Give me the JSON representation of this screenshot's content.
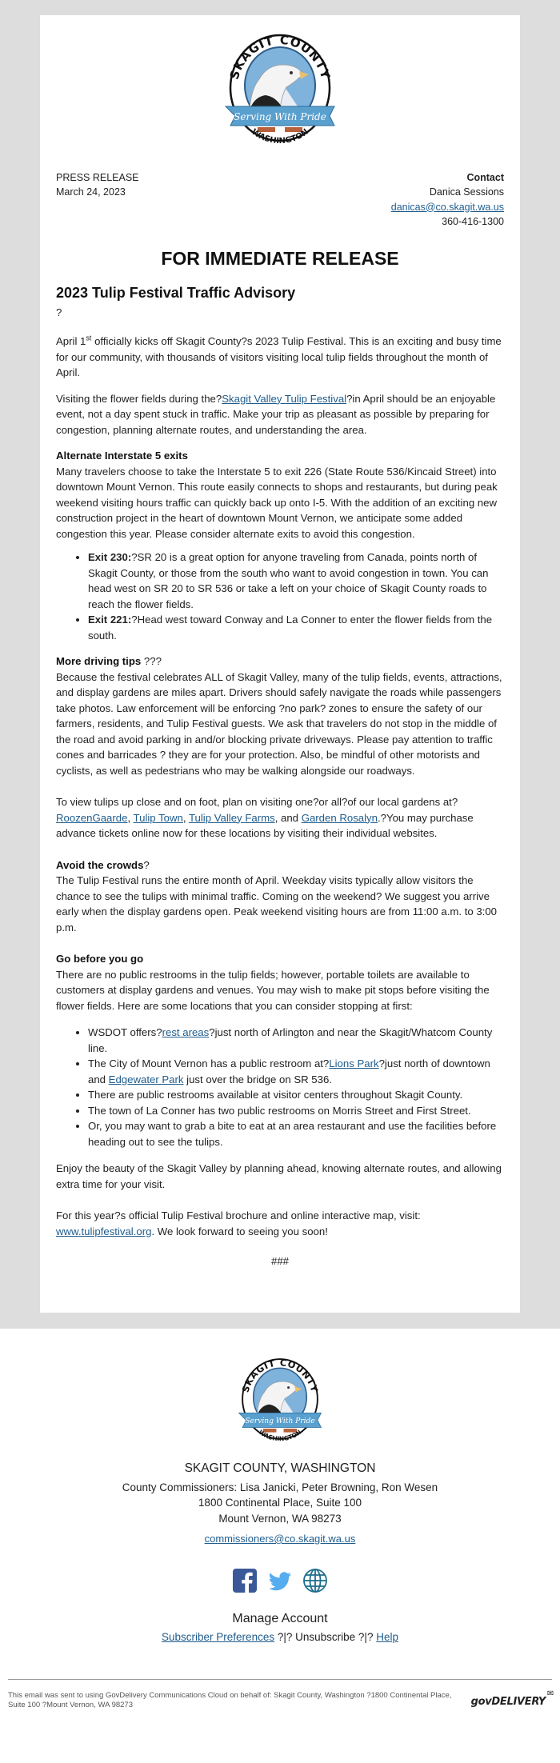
{
  "logo": {
    "top_text": "SKAGIT COUNTY",
    "ribbon_text": "Serving With Pride",
    "bottom_text": "WASHINGTON"
  },
  "header": {
    "left_line1": "PRESS RELEASE",
    "left_line2": "March 24, 2023",
    "contact_label": "Contact",
    "contact_name": "Danica Sessions",
    "contact_email": "danicas@co.skagit.wa.us",
    "contact_phone": "360-416-1300"
  },
  "release_heading": "FOR IMMEDIATE RELEASE",
  "title": "2023 Tulip Festival Traffic Advisory",
  "stray_char": "?",
  "intro": {
    "p1_a": "April 1",
    "p1_sup": "st",
    "p1_b": " officially kicks off Skagit County?s 2023 Tulip Festival. This is an exciting and busy time for our community, with thousands of visitors visiting local tulip fields throughout the month of April.",
    "p2_a": "Visiting the flower fields during the?",
    "p2_link": "Skagit Valley Tulip Festival",
    "p2_b": "?in April should be an enjoyable event, not a day spent stuck in traffic. Make your trip as pleasant as possible by preparing for congestion, planning alternate routes, and understanding the area."
  },
  "alt_exits": {
    "heading": "Alternate Interstate 5 exits",
    "body": "Many travelers choose to take the Interstate 5 to exit 226 (State Route 536/Kincaid Street) into downtown Mount Vernon. This route easily connects to shops and restaurants, but during peak weekend visiting hours traffic can quickly back up onto I-5. With the addition of an exciting new construction project in the heart of downtown Mount Vernon, we anticipate some added congestion this year. Please consider alternate exits to avoid this congestion.",
    "items": [
      {
        "label": "Exit 230:",
        "text": "?SR 20 is a great option for anyone traveling from Canada, points north of Skagit County, or those from the south who want to avoid congestion in town. You can head west on SR 20 to SR 536 or take a left on your choice of Skagit County roads to reach the flower fields."
      },
      {
        "label": "Exit 221:",
        "text": "?Head west toward Conway and La Conner to enter the flower fields from the south."
      }
    ]
  },
  "driving_tips": {
    "heading": "More driving tips",
    "heading_suffix": " ???",
    "body": "Because the festival celebrates ALL of Skagit Valley, many of the tulip fields, events, attractions, and display gardens are miles apart. Drivers should safely navigate the roads while passengers take photos. Law enforcement will be enforcing ?no park? zones to ensure the safety of our farmers, residents, and Tulip Festival guests. We ask that travelers do not stop in the middle of the road and avoid parking in and/or blocking private driveways. Please pay attention to traffic cones and barricades ? they are for your protection. Also, be mindful of other motorists and cyclists, as well as pedestrians who may be walking alongside our roadways."
  },
  "gardens": {
    "text_a": "To view tulips up close and on foot, plan on visiting one?or all?of our local gardens at?",
    "links": [
      "RoozenGaarde",
      "Tulip Town",
      "Tulip Valley Farms",
      "Garden Rosalyn"
    ],
    "sep1": ", ",
    "sep2": ", ",
    "sep3": ", and ",
    "text_b": ".?You may purchase advance tickets online now for these locations by visiting their individual websites."
  },
  "crowds": {
    "heading": "Avoid the crowds",
    "heading_suffix": "?",
    "body": "The Tulip Festival runs the entire month of April. Weekday visits typically allow visitors the chance to see the tulips with minimal traffic. Coming on the weekend? We suggest you arrive early when the display gardens open. Peak weekend visiting hours are from 11:00 a.m. to 3:00 p.m."
  },
  "restrooms": {
    "heading": "Go before you go",
    "body": "There are no public restrooms in the tulip fields; however, portable toilets are available to customers at display gardens and venues. You may wish to make pit stops before visiting the flower fields. Here are some locations that you can consider stopping at first:",
    "item1_a": "WSDOT offers?",
    "item1_link": "rest areas",
    "item1_b": "?just north of Arlington and near the Skagit/Whatcom County line.",
    "item2_a": "The City of Mount Vernon has a public restroom at?",
    "item2_link1": "Lions Park",
    "item2_b": "?just north of downtown and ",
    "item2_link2": "Edgewater Park",
    "item2_c": " just over the bridge on SR 536.",
    "item3": "There are public restrooms available at visitor centers throughout Skagit County.",
    "item4": "The town of La Conner has two public restrooms on Morris Street and First Street.",
    "item5": "Or, you may want to grab a bite to eat at an area restaurant and use the facilities before heading out to see the tulips."
  },
  "closing": {
    "p1": "Enjoy the beauty of the Skagit Valley by planning ahead, knowing alternate routes, and allowing extra time for your visit.",
    "p2_a": "For this year?s official Tulip Festival brochure and online interactive map, visit: ",
    "p2_link": "www.tulipfestival.org",
    "p2_b": ". We look forward to seeing you soon!",
    "end_mark": "###"
  },
  "footer": {
    "org": "SKAGIT COUNTY, WASHINGTON",
    "commissioners": "County Commissioners: Lisa Janicki, Peter Browning, Ron Wesen",
    "address1": "1800 Continental Place, Suite 100",
    "address2": "Mount Vernon, WA 98273",
    "email": "commissioners@co.skagit.wa.us",
    "social": [
      "facebook-icon",
      "twitter-icon",
      "globe-icon"
    ],
    "manage_account": "Manage Account",
    "subscriber_prefs": "Subscriber Preferences",
    "sep": " ?|? ",
    "unsubscribe": "Unsubscribe",
    "help": "Help",
    "disclaimer": "This email was sent to using GovDelivery Communications Cloud on behalf of: Skagit County, Washington ?1800 Continental Place, Suite 100 ?Mount Vernon, WA 98273",
    "govdelivery": "govDELIVERY"
  },
  "colors": {
    "link": "#1f5c8c",
    "outer_bg": "#dddddd",
    "facebook": "#3b5998",
    "twitter": "#55acee",
    "globe": "#1f6e8c"
  }
}
